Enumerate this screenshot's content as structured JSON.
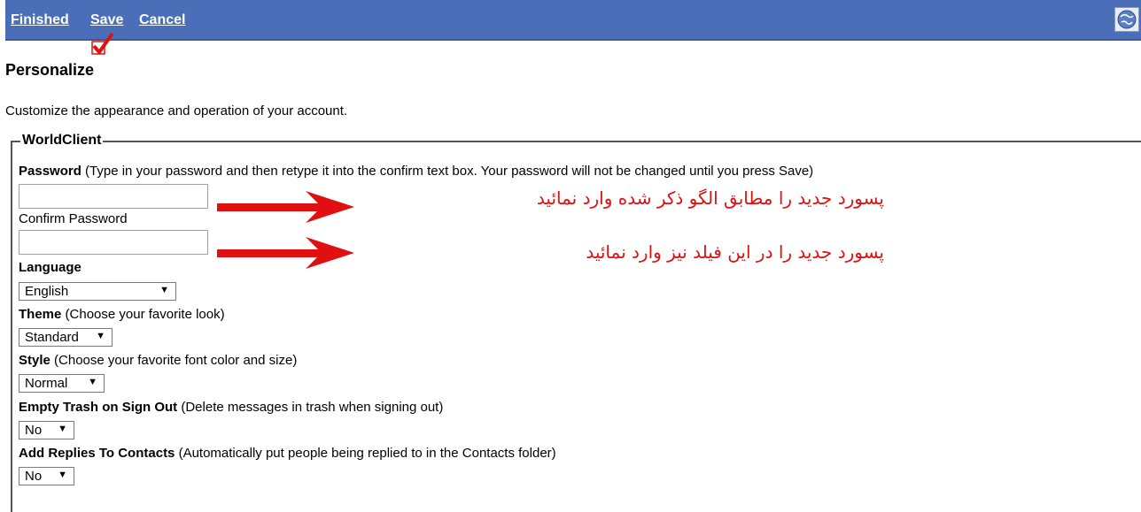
{
  "toolbar": {
    "finished_label": "Finished",
    "save_label": "Save",
    "cancel_label": "Cancel",
    "bg_color": "#4a6eb8"
  },
  "page": {
    "title": "Personalize",
    "description": "Customize the appearance and operation of your account."
  },
  "group": {
    "legend": "WorldClient"
  },
  "password": {
    "label": "Password",
    "hint": "(Type in your password and then retype it into the confirm text box. Your password will not be changed until you press Save)",
    "value": "",
    "confirm_label": "Confirm Password",
    "confirm_value": ""
  },
  "language": {
    "label": "Language",
    "selected": "English"
  },
  "theme": {
    "label": "Theme",
    "hint": "(Choose your favorite look)",
    "selected": "Standard"
  },
  "style": {
    "label": "Style",
    "hint": "(Choose your favorite font color and size)",
    "selected": "Normal"
  },
  "empty_trash": {
    "label": "Empty Trash on Sign Out",
    "hint": "(Delete messages in trash when signing out)",
    "selected": "No"
  },
  "add_replies": {
    "label": "Add Replies To Contacts",
    "hint": "(Automatically put people being replied to in the Contacts folder)",
    "selected": "No"
  },
  "annotations": {
    "password_note": "پسورد جدید را مطابق الگو ذکر شده وارد نمائید",
    "confirm_note": "پسورد جدید را در این فیلد نیز وارد نمائید",
    "color": "#e01010"
  }
}
